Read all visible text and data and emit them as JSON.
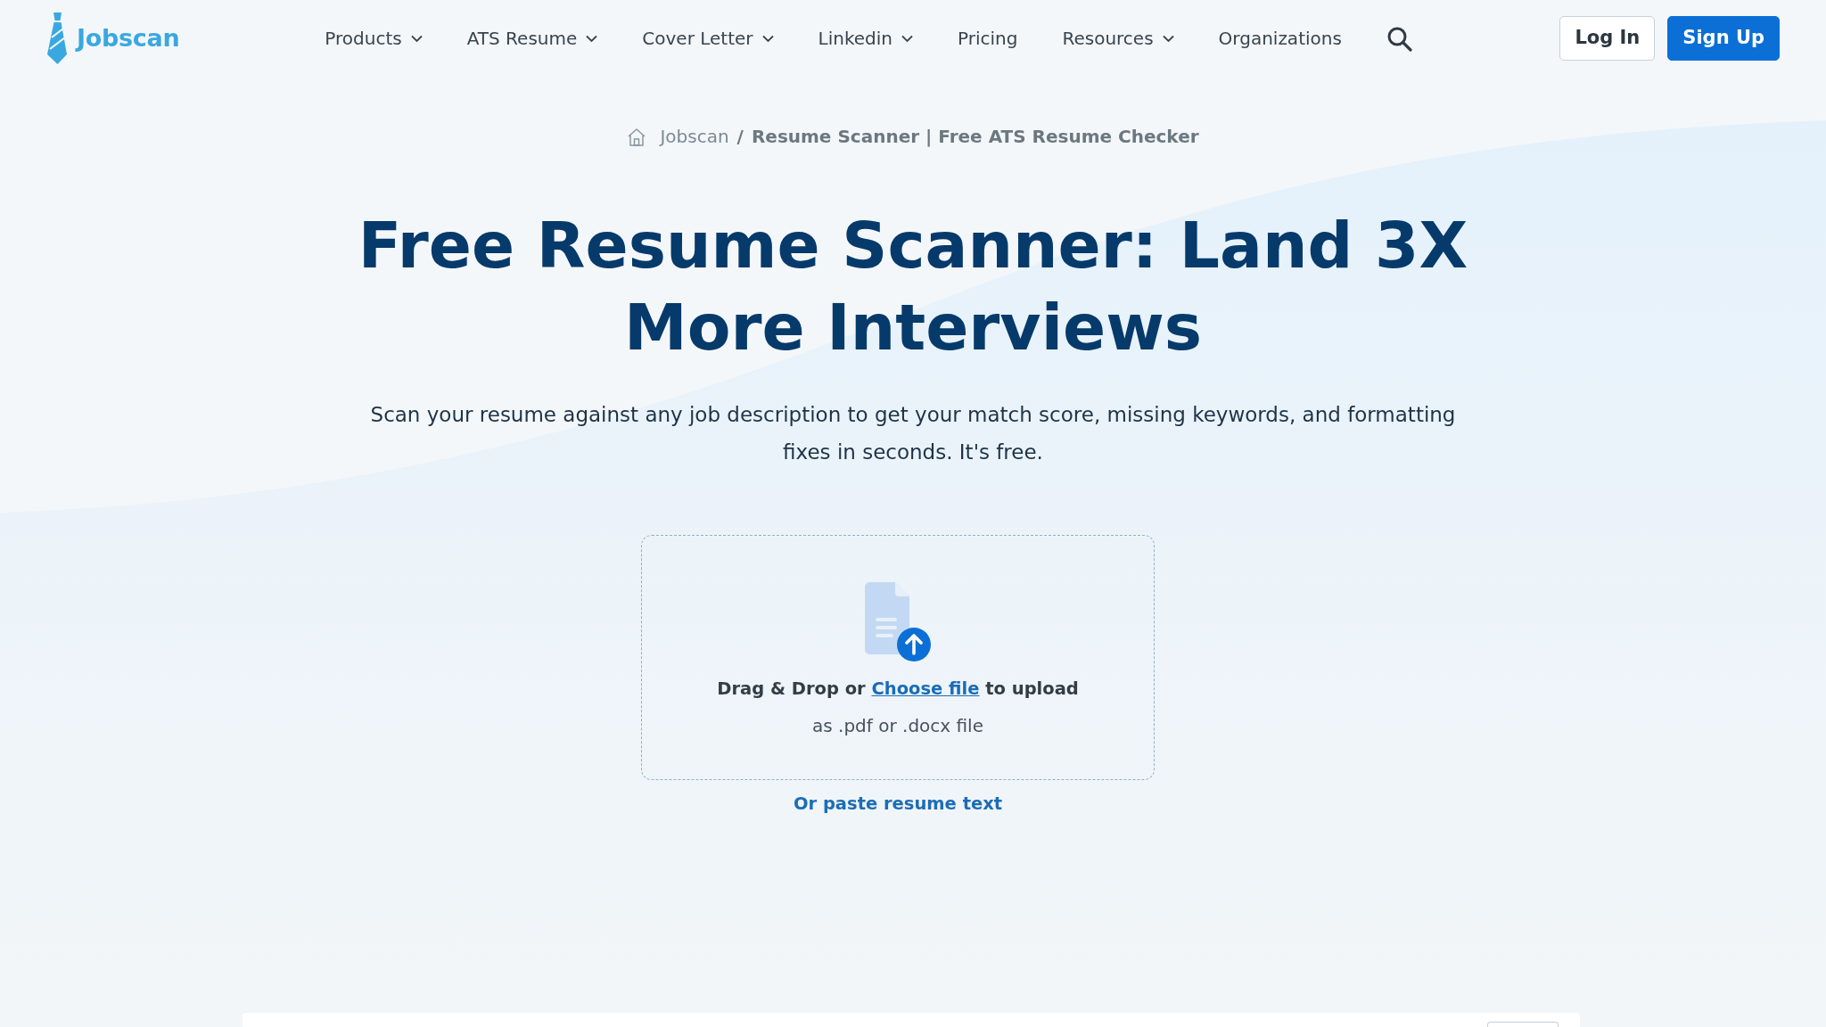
{
  "header": {
    "logo": "Jobscan",
    "nav": [
      {
        "label": "Products",
        "dropdown": true
      },
      {
        "label": "ATS Resume",
        "dropdown": true
      },
      {
        "label": "Cover Letter",
        "dropdown": true
      },
      {
        "label": "Linkedin",
        "dropdown": true
      },
      {
        "label": "Pricing",
        "dropdown": false
      },
      {
        "label": "Resources",
        "dropdown": true
      },
      {
        "label": "Organizations",
        "dropdown": false
      }
    ],
    "buttons": [
      {
        "label": "Log In",
        "kind": "outline"
      },
      {
        "label": "Sign Up",
        "kind": "primary"
      }
    ]
  },
  "breadcrumb": {
    "items": [
      {
        "label": "Jobscan",
        "kind": "home"
      },
      {
        "label": "Resume Scanner | Free ATS Resume Checker",
        "kind": "current"
      }
    ],
    "separator": "/"
  },
  "hero": {
    "title": "Free Resume Scanner: Land 3X More Interviews",
    "subtitle": "Scan your resume against any job description to get your match score, missing keywords, and formatting fixes in seconds. It's free."
  },
  "upload": {
    "prompt_start": "Drag & Drop or",
    "link": "Choose file",
    "prompt_end": "to upload",
    "hint": "as .pdf or .docx file"
  },
  "paste_link": "Or paste resume text"
}
